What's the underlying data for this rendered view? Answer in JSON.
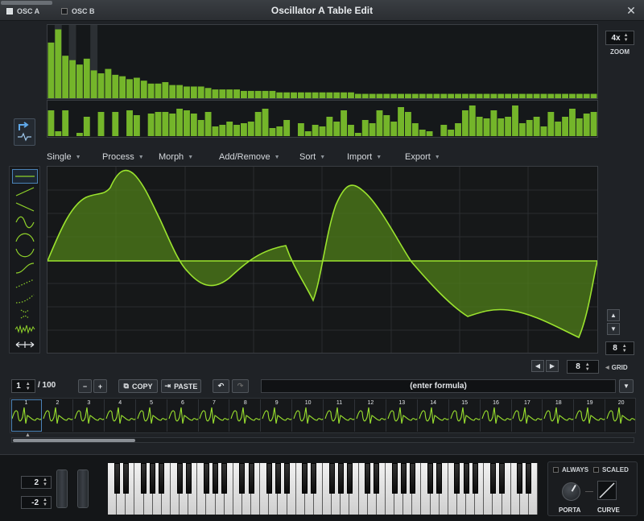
{
  "window": {
    "title": "Oscillator A Table Edit"
  },
  "osc_tabs": [
    {
      "label": "OSC A",
      "active": true
    },
    {
      "label": "OSC B",
      "active": false
    }
  ],
  "zoom": {
    "value": "4x",
    "label": "ZOOM"
  },
  "harmonics": {
    "magnitudes": [
      0.38,
      0.47,
      0.29,
      0.26,
      0.23,
      0.27,
      0.19,
      0.17,
      0.2,
      0.16,
      0.15,
      0.13,
      0.14,
      0.12,
      0.1,
      0.1,
      0.11,
      0.09,
      0.09,
      0.08,
      0.08,
      0.08,
      0.07,
      0.06,
      0.06,
      0.06,
      0.06,
      0.05,
      0.05,
      0.05,
      0.05,
      0.05,
      0.04,
      0.04,
      0.04,
      0.04,
      0.04,
      0.04,
      0.04,
      0.04,
      0.04,
      0.04,
      0.04,
      0.03,
      0.03,
      0.03,
      0.03,
      0.03,
      0.03,
      0.03,
      0.03,
      0.03,
      0.03,
      0.03,
      0.03,
      0.03,
      0.03,
      0.03,
      0.03,
      0.03,
      0.03,
      0.03,
      0.03,
      0.03,
      0.03,
      0.03,
      0.03,
      0.03,
      0.03,
      0.03,
      0.03,
      0.03,
      0.03,
      0.03,
      0.03,
      0.03,
      0.03
    ],
    "phases": [
      0.8,
      0.15,
      0.8,
      0,
      0.1,
      0.6,
      0,
      0.75,
      0,
      0.75,
      0,
      0.8,
      0.65,
      0,
      0.7,
      0.75,
      0.75,
      0.7,
      0.85,
      0.8,
      0.7,
      0.5,
      0.75,
      0.3,
      0.35,
      0.45,
      0.35,
      0.4,
      0.45,
      0.75,
      0.85,
      0.25,
      0.3,
      0.5,
      0,
      0.4,
      0.15,
      0.35,
      0.3,
      0.6,
      0.45,
      0.8,
      0.35,
      0.1,
      0.5,
      0.4,
      0.8,
      0.65,
      0.45,
      0.9,
      0.75,
      0.4,
      0.2,
      0.15,
      0,
      0.35,
      0.2,
      0.4,
      0.8,
      0.95,
      0.6,
      0.55,
      0.8,
      0.55,
      0.6,
      0.95,
      0.4,
      0.5,
      0.6,
      0.3,
      0.75,
      0.45,
      0.6,
      0.85,
      0.55,
      0.7,
      0.75
    ]
  },
  "menus": [
    "Single",
    "Process",
    "Morph",
    "Add/Remove",
    "Sort",
    "Import",
    "Export"
  ],
  "wave_tools": [
    "flat",
    "ramp-up",
    "ramp-down",
    "sine",
    "half-sine",
    "arch",
    "s-curve",
    "dots-up",
    "dots-rise",
    "dots-sine",
    "noise",
    "stretch"
  ],
  "grid": {
    "value": "8",
    "label": "GRID"
  },
  "frame_nav": {
    "current": "1",
    "total": "/ 100"
  },
  "toolbar": {
    "copy": "COPY",
    "paste": "PASTE",
    "formula_placeholder": "(enter formula)"
  },
  "frames": [
    "1",
    "2",
    "3",
    "4",
    "5",
    "6",
    "7",
    "8",
    "9",
    "10",
    "11",
    "12",
    "13",
    "14",
    "15",
    "16",
    "17",
    "18",
    "19",
    "20"
  ],
  "bottom": {
    "pitch_up": "2",
    "pitch_down": "-2",
    "always": "ALWAYS",
    "scaled": "SCALED",
    "porta": "PORTA",
    "curve": "CURVE"
  },
  "colors": {
    "accent_green": "#8fd12a",
    "fill_green": "#4f7d18",
    "select_blue": "#4b83b7"
  }
}
